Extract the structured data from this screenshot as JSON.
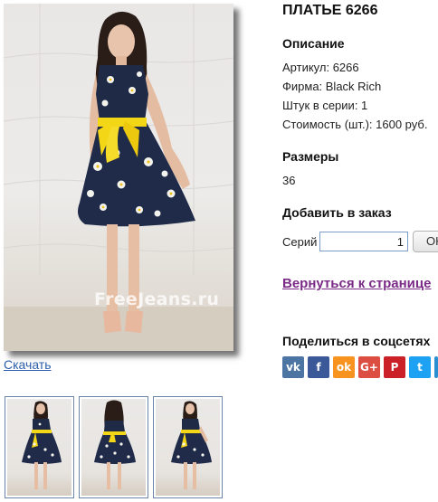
{
  "product": {
    "title": "ПЛАТЬЕ 6266",
    "watermark": "FreeJeans.ru",
    "download_label": "Скачать"
  },
  "description": {
    "heading": "Описание",
    "article": "Артикул: 6266",
    "brand": "Фирма: Black Rich",
    "pieces": "Штук в серии: 1",
    "price": "Стоимость (шт.): 1600 руб."
  },
  "sizes": {
    "heading": "Размеры",
    "values": "36"
  },
  "order": {
    "heading": "Добавить в заказ",
    "series_label": "Серий",
    "quantity": "1",
    "ok_label": "OK"
  },
  "back_link": "Вернуться к странице",
  "share": {
    "heading": "Поделиться в соцсетях",
    "buttons": [
      {
        "name": "vk",
        "glyph": "vk",
        "color": "#4c75a3"
      },
      {
        "name": "facebook",
        "glyph": "f",
        "color": "#3b5998"
      },
      {
        "name": "odnoklassniki",
        "glyph": "ok",
        "color": "#f7931e"
      },
      {
        "name": "google-plus",
        "glyph": "G+",
        "color": "#dc4e41"
      },
      {
        "name": "pinterest",
        "glyph": "P",
        "color": "#cb2027"
      },
      {
        "name": "twitter",
        "glyph": "t",
        "color": "#1da1f2"
      },
      {
        "name": "more",
        "glyph": "",
        "color": "#2a8fd0"
      }
    ]
  },
  "thumbnails": [
    "front",
    "back",
    "front-2"
  ]
}
